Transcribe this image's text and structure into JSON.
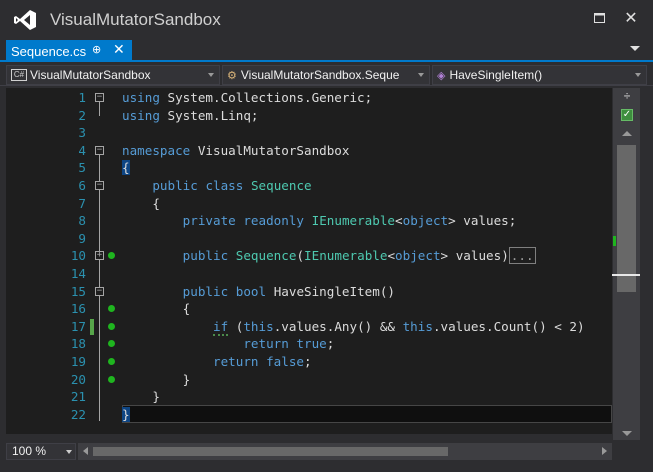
{
  "window": {
    "title": "VisualMutatorSandbox",
    "accent_color": "#007acc"
  },
  "tab": {
    "label": "Sequence.cs",
    "pin_glyph": "⊕",
    "close_glyph": "✕"
  },
  "navbar": {
    "project": "VisualMutatorSandbox",
    "type": "VisualMutatorSandbox.Seque",
    "member": "HaveSingleItem()"
  },
  "editor": {
    "line_numbers": [
      "1",
      "2",
      "3",
      "4",
      "5",
      "6",
      "7",
      "8",
      "9",
      "10",
      "14",
      "15",
      "16",
      "17",
      "18",
      "19",
      "20",
      "21",
      "22"
    ],
    "collapsed_marker": "...",
    "breakpoint_color": "#1fb51f"
  },
  "bottom": {
    "zoom": "100 %"
  },
  "icons": {
    "vs_logo": "visual-studio-logo-icon",
    "class_icon": "class-icon",
    "method_icon": "method-icon",
    "cs_icon": "csharp-project-icon"
  }
}
